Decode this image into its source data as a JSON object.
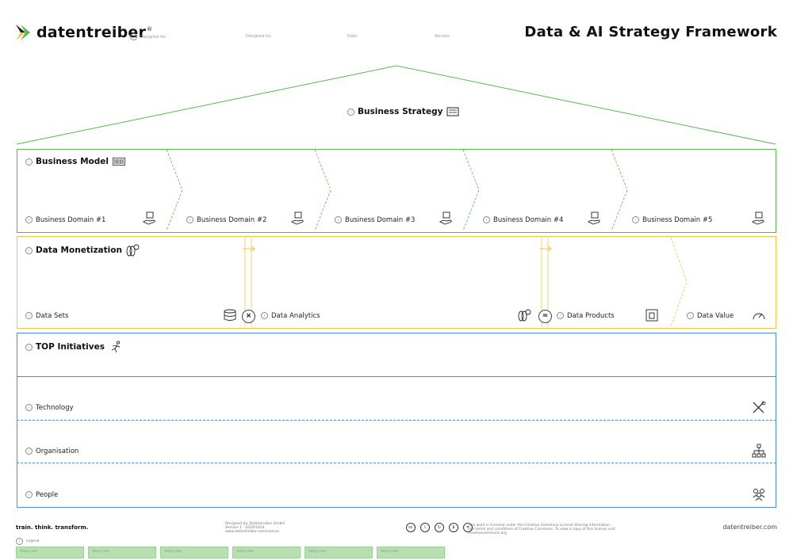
{
  "header": {
    "logo_text": "datentreiber",
    "logo_mark": "®",
    "meta": {
      "designed_for": "Designed for:",
      "designed_by": "Designed by:",
      "date": "Date:",
      "version": "Version:"
    },
    "title": "Data & AI Strategy Framework"
  },
  "strategy": {
    "label": "Business Strategy",
    "icon": "strategy-board-icon"
  },
  "business_model": {
    "label": "Business Model",
    "icon": "barcode-icon",
    "domains": [
      "Business Domain #1",
      "Business Domain #2",
      "Business Domain #3",
      "Business Domain #4",
      "Business Domain #5"
    ],
    "domain_icon": "hand-box-icon"
  },
  "monetization": {
    "label": "Data Monetization",
    "icon": "coins-icon",
    "items": [
      {
        "label": "Data Sets",
        "icon": "database-icon"
      },
      {
        "label": "Data Analytics",
        "icon": "coins-icon"
      },
      {
        "label": "Data Products",
        "icon": "product-box-icon"
      },
      {
        "label": "Data Value",
        "icon": "gauge-icon"
      }
    ],
    "ops": [
      "×",
      "="
    ]
  },
  "top": {
    "label": "TOP Initiatives",
    "icon": "runner-icon",
    "rows": [
      {
        "label": "Technology",
        "icon": "tools-icon"
      },
      {
        "label": "Organisation",
        "icon": "org-chart-icon"
      },
      {
        "label": "People",
        "icon": "people-icon"
      }
    ]
  },
  "footer": {
    "tagline": "train. think. transform.",
    "credits": [
      "Designed by: Datentreiber GmbH",
      "Version 1 · 2020/2024",
      "www.datentreiber.com/canvas"
    ],
    "license": "This work is licensed under the Creative Commons License Sharing information - see terms and conditions of Creative Commons. To view a copy of this license visit creativecommons.org",
    "website": "datentreiber.com",
    "legend": "Legend",
    "stickies": [
      "Sticky note",
      "Sticky note",
      "Sticky note",
      "Sticky note",
      "Sticky note",
      "Sticky note"
    ]
  },
  "colors": {
    "green": "#5ab552",
    "yellow": "#f4c542",
    "blue": "#4a90d9"
  }
}
